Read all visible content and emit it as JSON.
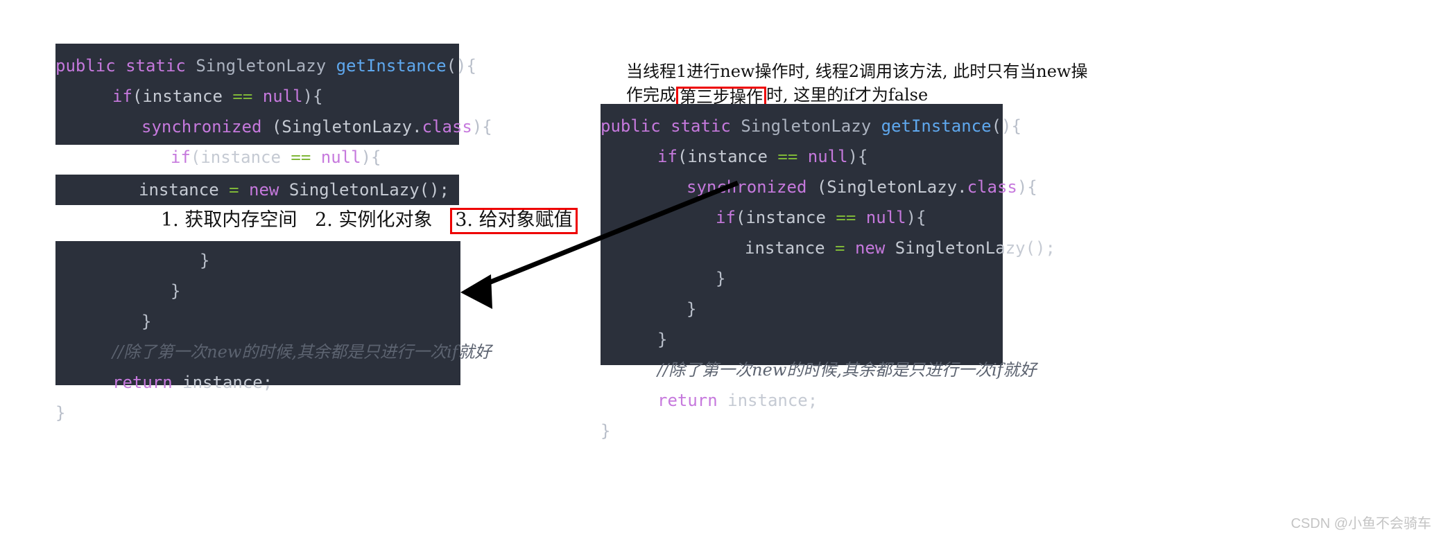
{
  "page": {
    "background_color": "#ffffff",
    "code_background_color": "#2b303b",
    "accent_red": "#ee0000",
    "watermark": "CSDN @小鱼不会骑车"
  },
  "left_column": {
    "block_top": {
      "lines": [
        {
          "indent": 0,
          "tokens": [
            {
              "t": "public ",
              "c": "kw"
            },
            {
              "t": "static ",
              "c": "kw"
            },
            {
              "t": "SingletonLazy ",
              "c": "type"
            },
            {
              "t": "getInstance",
              "c": "fn"
            },
            {
              "t": "(){",
              "c": "punct"
            }
          ]
        },
        {
          "indent": 1,
          "tokens": [
            {
              "t": "if",
              "c": "kw"
            },
            {
              "t": "(instance ",
              "c": "plain"
            },
            {
              "t": "== ",
              "c": "op"
            },
            {
              "t": "null",
              "c": "kw"
            },
            {
              "t": "){",
              "c": "punct"
            }
          ]
        },
        {
          "indent": 2,
          "tokens": [
            {
              "t": "synchronized ",
              "c": "kw"
            },
            {
              "t": "(SingletonLazy.",
              "c": "plain"
            },
            {
              "t": "class",
              "c": "kw"
            },
            {
              "t": "){",
              "c": "punct"
            }
          ]
        },
        {
          "indent": 3,
          "tokens": [
            {
              "t": "if",
              "c": "kw"
            },
            {
              "t": "(instance ",
              "c": "plain"
            },
            {
              "t": "== ",
              "c": "op"
            },
            {
              "t": "null",
              "c": "kw"
            },
            {
              "t": "){",
              "c": "punct"
            }
          ]
        }
      ]
    },
    "block_mid": {
      "lines": [
        {
          "indent": 0,
          "align": "right",
          "tokens": [
            {
              "t": "instance ",
              "c": "plain"
            },
            {
              "t": "= ",
              "c": "op"
            },
            {
              "t": "new ",
              "c": "kw"
            },
            {
              "t": "SingletonLazy();",
              "c": "plain"
            }
          ]
        }
      ]
    },
    "block_bottom": {
      "lines": [
        {
          "indent": 4,
          "tokens": [
            {
              "t": "}",
              "c": "punct"
            }
          ]
        },
        {
          "indent": 3,
          "tokens": [
            {
              "t": "}",
              "c": "punct"
            }
          ]
        },
        {
          "indent": 2,
          "tokens": [
            {
              "t": "}",
              "c": "punct"
            }
          ]
        },
        {
          "indent": 1,
          "tokens": [
            {
              "t": "//除了第一次new的时候,其余都是只进行一次if就好",
              "c": "comment"
            }
          ]
        },
        {
          "indent": 1,
          "tokens": [
            {
              "t": "return ",
              "c": "kw"
            },
            {
              "t": "instance;",
              "c": "plain"
            }
          ]
        },
        {
          "indent": 0,
          "tokens": [
            {
              "t": "}",
              "c": "punct"
            }
          ]
        }
      ]
    }
  },
  "right_column": {
    "block": {
      "lines": [
        {
          "indent": 0,
          "tokens": [
            {
              "t": "public ",
              "c": "kw"
            },
            {
              "t": "static ",
              "c": "kw"
            },
            {
              "t": "SingletonLazy ",
              "c": "type"
            },
            {
              "t": "getInstance",
              "c": "fn"
            },
            {
              "t": "(){",
              "c": "punct"
            }
          ]
        },
        {
          "indent": 1,
          "tokens": [
            {
              "t": "if",
              "c": "kw"
            },
            {
              "t": "(instance ",
              "c": "plain"
            },
            {
              "t": "== ",
              "c": "op"
            },
            {
              "t": "null",
              "c": "kw"
            },
            {
              "t": "){",
              "c": "punct"
            }
          ]
        },
        {
          "indent": 2,
          "tokens": [
            {
              "t": "synchronized ",
              "c": "kw"
            },
            {
              "t": "(SingletonLazy.",
              "c": "plain"
            },
            {
              "t": "class",
              "c": "kw"
            },
            {
              "t": "){",
              "c": "punct"
            }
          ]
        },
        {
          "indent": 3,
          "tokens": [
            {
              "t": "if",
              "c": "kw"
            },
            {
              "t": "(instance ",
              "c": "plain"
            },
            {
              "t": "== ",
              "c": "op"
            },
            {
              "t": "null",
              "c": "kw"
            },
            {
              "t": "){",
              "c": "punct"
            }
          ]
        },
        {
          "indent": 4,
          "tokens": [
            {
              "t": "instance ",
              "c": "plain"
            },
            {
              "t": "= ",
              "c": "op"
            },
            {
              "t": "new ",
              "c": "kw"
            },
            {
              "t": "SingletonLazy();",
              "c": "plain"
            }
          ]
        },
        {
          "indent": 3,
          "tokens": [
            {
              "t": "}",
              "c": "punct"
            }
          ]
        },
        {
          "indent": 2,
          "tokens": [
            {
              "t": "}",
              "c": "punct"
            }
          ]
        },
        {
          "indent": 1,
          "tokens": [
            {
              "t": "}",
              "c": "punct"
            }
          ]
        },
        {
          "indent": 1,
          "tokens": [
            {
              "t": "//除了第一次new的时候,其余都是只进行一次if就好",
              "c": "comment"
            }
          ]
        },
        {
          "indent": 1,
          "tokens": [
            {
              "t": "return ",
              "c": "kw"
            },
            {
              "t": "instance;",
              "c": "plain"
            }
          ]
        },
        {
          "indent": 0,
          "tokens": [
            {
              "t": "}",
              "c": "punct"
            }
          ]
        }
      ]
    }
  },
  "annotations": {
    "steps": {
      "step1": "1. 获取内存空间",
      "step2": "2. 实例化对象",
      "step3_highlighted": "3. 给对象赋值"
    },
    "thread_note": {
      "line1_before": "当线程1进行new操作时, 线程2调用该方法, 此时只有当new操",
      "line2_before": "作完成",
      "line2_highlighted": "第三步操作",
      "line2_after": "时, 这里的if才为false"
    }
  }
}
